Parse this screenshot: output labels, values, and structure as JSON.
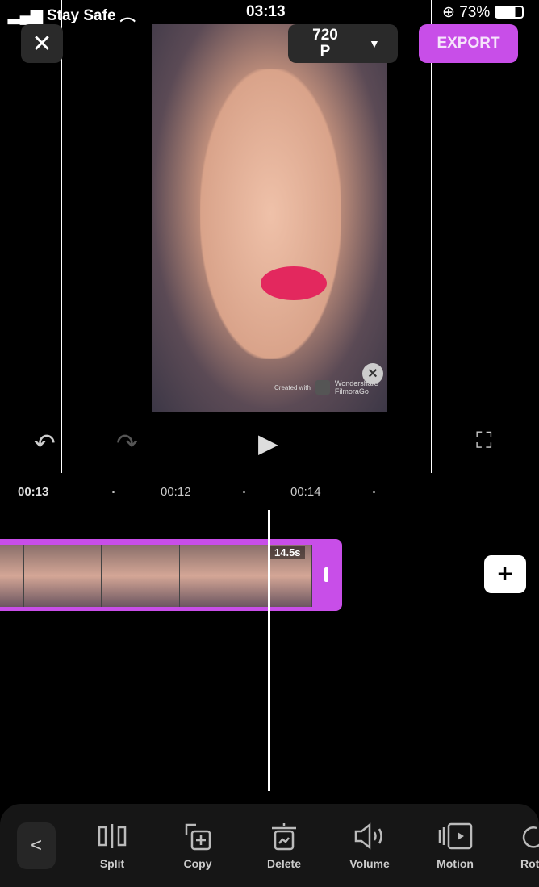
{
  "status": {
    "carrier": "Stay Safe",
    "time": "03:13",
    "battery": "73%"
  },
  "header": {
    "close_icon": "close-icon",
    "resolution": "720\nP",
    "export_label": "EXPORT",
    "accent": "#c84ee8"
  },
  "preview": {
    "watermark_small": "Created with",
    "watermark_brand": "Wondershare\nFilmoraGo"
  },
  "timeline": {
    "ticks": [
      "00:13",
      "00:12",
      "00:14"
    ],
    "clip_duration": "14.5s"
  },
  "toolbar": {
    "items": [
      {
        "label": "Split",
        "icon": "split-icon"
      },
      {
        "label": "Copy",
        "icon": "copy-icon"
      },
      {
        "label": "Delete",
        "icon": "delete-icon"
      },
      {
        "label": "Volume",
        "icon": "volume-icon"
      },
      {
        "label": "Motion",
        "icon": "motion-icon"
      },
      {
        "label": "Rot",
        "icon": "rotate-icon"
      }
    ]
  }
}
